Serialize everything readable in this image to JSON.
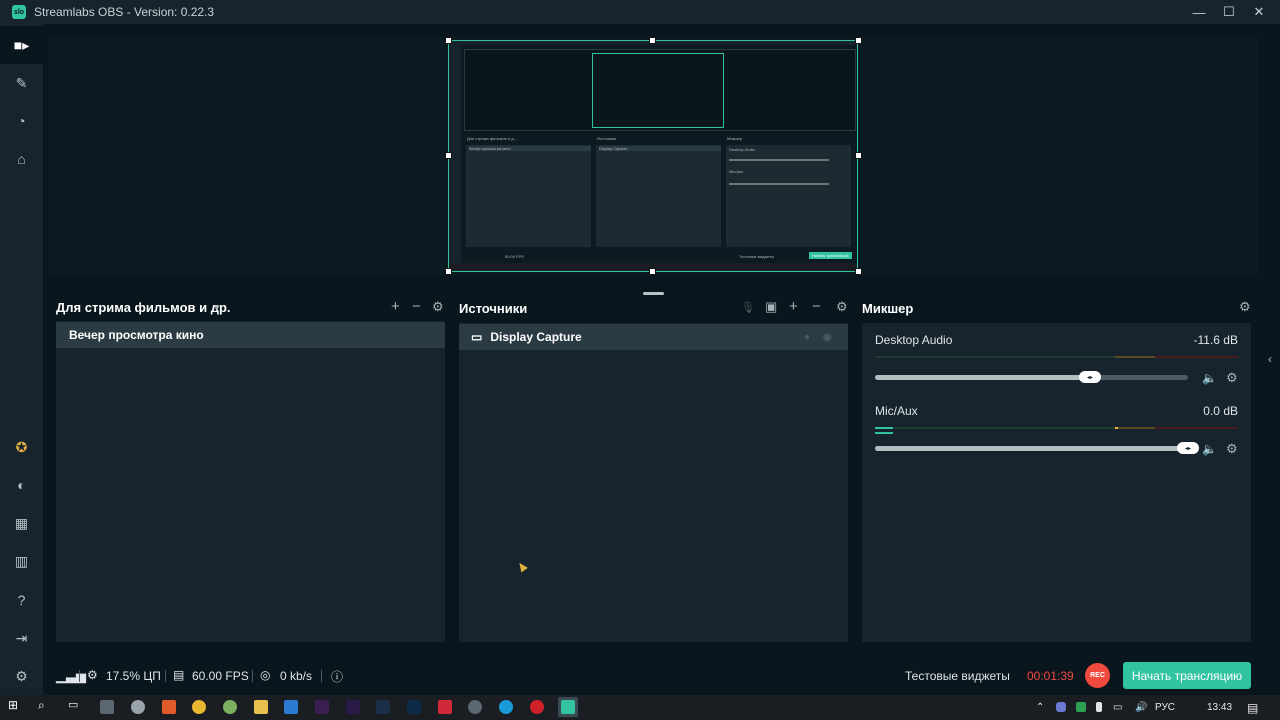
{
  "app": {
    "title": "Streamlabs OBS - Version: 0.22.3",
    "logo_text": "slo",
    "window_buttons": [
      "—",
      "☐",
      "✕"
    ]
  },
  "nav": {
    "top": [
      {
        "name": "editor",
        "icon": "■▸",
        "active": true
      },
      {
        "name": "themes",
        "icon": "✎"
      },
      {
        "name": "dashboard",
        "icon": "◔"
      },
      {
        "name": "store",
        "icon": "⌂"
      }
    ],
    "bottom": [
      {
        "name": "prime",
        "icon": "✪"
      },
      {
        "name": "alertbox",
        "icon": "◐"
      },
      {
        "name": "layout",
        "icon": "▦"
      },
      {
        "name": "studio-mode",
        "icon": "▥"
      },
      {
        "name": "help",
        "icon": "?"
      },
      {
        "name": "login",
        "icon": "⇥"
      },
      {
        "name": "settings",
        "icon": "⚙"
      }
    ]
  },
  "preview": {
    "mini": {
      "scenes_title": "Для стрима фильмов и д...",
      "scene_item": "Вечер просмотра кино",
      "sources_title": "Источники",
      "source_item": "Display Capture",
      "mixer_title": "Микшер",
      "desktop": "Desktop Audio",
      "mic": "Mic/Aux",
      "fps": "60.00 FPS",
      "golive": "Начать трансляцию",
      "widgets": "Тестовые виджеты"
    }
  },
  "scenes": {
    "title": "Для стрима фильмов и др.",
    "dropdown_icon": "▾",
    "add": "+",
    "remove": "−",
    "settings": "⚙",
    "items": [
      "Вечер просмотра кино"
    ]
  },
  "sources": {
    "title": "Источники",
    "mic_icon": "🎙",
    "folder_icon": "▣",
    "add": "+",
    "remove": "−",
    "settings": "⚙",
    "items": [
      {
        "label": "Display Capture",
        "icon": "▭"
      }
    ]
  },
  "mixer": {
    "title": "Микшер",
    "settings": "⚙",
    "channels": [
      {
        "name": "Desktop Audio",
        "db": "-11.6 dB",
        "volume": 0.68,
        "level": 0
      },
      {
        "name": "Mic/Aux",
        "db": "0.0 dB",
        "volume": 1.0,
        "level": 0.05
      }
    ]
  },
  "footer": {
    "cpu": "17.5% ЦП",
    "fps": "60.00 FPS",
    "bitrate": "0 kb/s",
    "widgets": "Тестовые виджеты",
    "timer": "00:01:39",
    "rec": "REC",
    "golive": "Начать трансляцию"
  },
  "taskbar": {
    "lang": "РУС",
    "time": "13:43"
  },
  "colors": {
    "accent": "#31c3a2",
    "rec": "#f04a3f",
    "bg": "#09161d",
    "panel": "#17242d"
  }
}
